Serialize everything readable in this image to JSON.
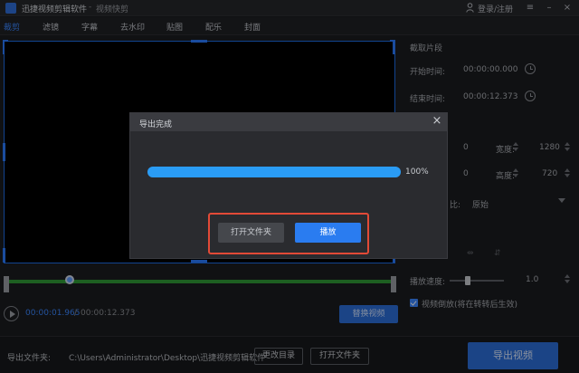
{
  "app": {
    "title": "迅捷视频剪辑软件",
    "separator": "-",
    "subtitle": "视频快剪",
    "login": "登录/注册"
  },
  "tabs": [
    {
      "label": "裁剪",
      "active": true
    },
    {
      "label": "滤镜",
      "active": false
    },
    {
      "label": "字幕",
      "active": false
    },
    {
      "label": "去水印",
      "active": false
    },
    {
      "label": "贴图",
      "active": false
    },
    {
      "label": "配乐",
      "active": false
    },
    {
      "label": "封面",
      "active": false
    }
  ],
  "right_panel": {
    "section_title": "截取片段",
    "start_label": "开始时间:",
    "start_value": "00:00:00.000",
    "end_label": "结束时间:",
    "end_value": "00:00:12.373",
    "x_value": "0",
    "width_label": "宽度:",
    "width_value": "1280",
    "y_value": "0",
    "height_label": "高度:",
    "height_value": "720",
    "ratio_label": "比:",
    "ratio_value": "原始",
    "speed_label": "播放速度:",
    "speed_value": "1.0",
    "reverse_label": "视频倒放(将在转转后生效)",
    "reverse_checked": true
  },
  "player": {
    "time_current": "00:00:01.965",
    "time_sep": "/",
    "time_total": "00:00:12.373",
    "replace_label": "替换视频"
  },
  "bottom": {
    "output_label": "导出文件夹:",
    "output_path": "C:\\Users\\Administrator\\Desktop\\迅捷视频剪辑软件",
    "change_dir": "更改目录",
    "open_folder": "打开文件夹",
    "export": "导出视频"
  },
  "dialog": {
    "title": "导出完成",
    "close": "×",
    "progress_value": 100,
    "progress_text": "100%",
    "open_folder": "打开文件夹",
    "play": "播放"
  },
  "colors": {
    "accent": "#2c6ed8",
    "progress": "#2a9cf5",
    "highlight": "#e24a37",
    "timeline": "#2f9a36"
  }
}
